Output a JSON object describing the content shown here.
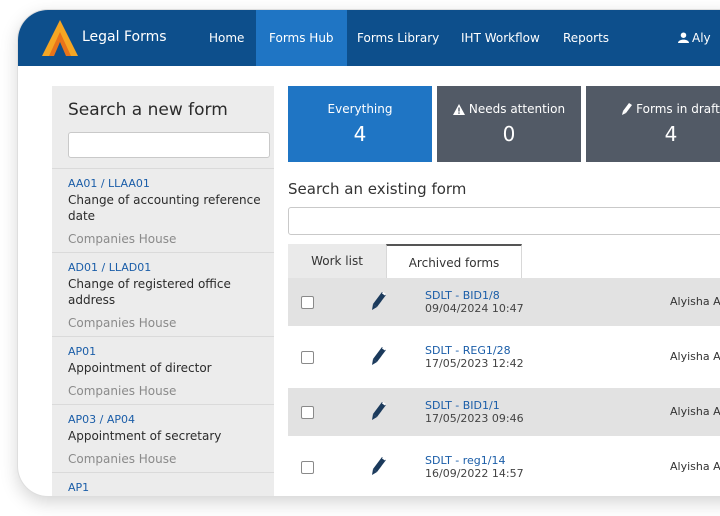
{
  "nav": {
    "brand": "Legal Forms",
    "items": [
      "Home",
      "Forms Hub",
      "Forms Library",
      "IHT Workflow",
      "Reports"
    ],
    "active_index": 1,
    "user_label": "Aly"
  },
  "sidebar": {
    "title": "Search a new form",
    "search_value": "",
    "forms": [
      {
        "code": "AA01 / LLAA01",
        "name": "Change of accounting reference date",
        "source": "Companies House"
      },
      {
        "code": "AD01 / LLAD01",
        "name": "Change of registered office address",
        "source": "Companies House"
      },
      {
        "code": "AP01",
        "name": "Appointment of director",
        "source": "Companies House"
      },
      {
        "code": "AP03 / AP04",
        "name": "Appointment of secretary",
        "source": "Companies House"
      },
      {
        "code": "AP1",
        "name": "",
        "source": ""
      }
    ]
  },
  "tiles": [
    {
      "label": "Everything",
      "count": "4",
      "icon": "",
      "color": "#1f75c4"
    },
    {
      "label": "Needs attention",
      "count": "0",
      "icon": "warning-icon",
      "color": "#525a66"
    },
    {
      "label": "Forms in draft",
      "count": "4",
      "icon": "pencil-icon",
      "color": "#525a66"
    }
  ],
  "main": {
    "search_title": "Search an existing form",
    "search_value": "",
    "tabs": [
      "Work list",
      "Archived forms"
    ],
    "active_tab": 0,
    "rows": [
      {
        "ref": "SDLT - BID1/8",
        "timestamp": "09/04/2024 10:47",
        "owner": "Alyisha Ar"
      },
      {
        "ref": "SDLT - REG1/28",
        "timestamp": "17/05/2023 12:42",
        "owner": "Alyisha Ar"
      },
      {
        "ref": "SDLT - BID1/1",
        "timestamp": "17/05/2023 09:46",
        "owner": "Alyisha Ar"
      },
      {
        "ref": "SDLT - reg1/14",
        "timestamp": "16/09/2022 14:57",
        "owner": "Alyisha Ar"
      }
    ]
  },
  "colors": {
    "nav_bg": "#0d4f8c",
    "nav_active": "#1f75c4",
    "link": "#1a5da8",
    "tile_blue": "#1f75c4",
    "tile_grey": "#525a66",
    "logo_orange": "#f5a623"
  }
}
